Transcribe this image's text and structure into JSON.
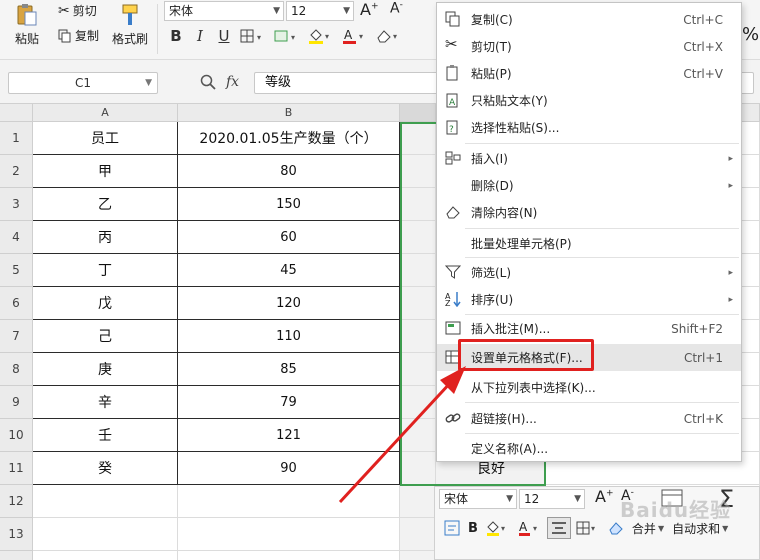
{
  "ribbon": {
    "paste": "粘贴",
    "cut": "剪切",
    "copy": "复制",
    "format_painter": "格式刷",
    "font_name": "宋体",
    "font_size": "12",
    "percent": "%"
  },
  "formula_bar": {
    "cell_ref": "C1",
    "fx": "fx",
    "value": "等级"
  },
  "grid": {
    "columns": [
      "A",
      "B"
    ],
    "rows": [
      {
        "num": "1",
        "a": "员工",
        "b": "2020.01.05生产数量（个）"
      },
      {
        "num": "2",
        "a": "甲",
        "b": "80"
      },
      {
        "num": "3",
        "a": "乙",
        "b": "150"
      },
      {
        "num": "4",
        "a": "丙",
        "b": "60"
      },
      {
        "num": "5",
        "a": "丁",
        "b": "45"
      },
      {
        "num": "6",
        "a": "戊",
        "b": "120"
      },
      {
        "num": "7",
        "a": "己",
        "b": "110"
      },
      {
        "num": "8",
        "a": "庚",
        "b": "85"
      },
      {
        "num": "9",
        "a": "辛",
        "b": "79"
      },
      {
        "num": "10",
        "a": "壬",
        "b": "121"
      },
      {
        "num": "11",
        "a": "癸",
        "b": "90"
      },
      {
        "num": "12",
        "a": "",
        "b": ""
      },
      {
        "num": "13",
        "a": "",
        "b": ""
      },
      {
        "num": "14",
        "a": "",
        "b": ""
      }
    ],
    "c11_value": "良好"
  },
  "context_menu": {
    "items": [
      {
        "label": "复制(C)",
        "shortcut": "Ctrl+C"
      },
      {
        "label": "剪切(T)",
        "shortcut": "Ctrl+X"
      },
      {
        "label": "粘贴(P)",
        "shortcut": "Ctrl+V"
      },
      {
        "label": "只粘贴文本(Y)",
        "shortcut": ""
      },
      {
        "label": "选择性粘贴(S)...",
        "shortcut": ""
      },
      {
        "label": "插入(I)",
        "shortcut": ""
      },
      {
        "label": "删除(D)",
        "shortcut": ""
      },
      {
        "label": "清除内容(N)",
        "shortcut": ""
      },
      {
        "label": "批量处理单元格(P)",
        "shortcut": ""
      },
      {
        "label": "筛选(L)",
        "shortcut": ""
      },
      {
        "label": "排序(U)",
        "shortcut": ""
      },
      {
        "label": "插入批注(M)...",
        "shortcut": "Shift+F2"
      },
      {
        "label": "设置单元格格式(F)...",
        "shortcut": "Ctrl+1"
      },
      {
        "label": "从下拉列表中选择(K)...",
        "shortcut": ""
      },
      {
        "label": "超链接(H)...",
        "shortcut": "Ctrl+K"
      },
      {
        "label": "定义名称(A)...",
        "shortcut": ""
      }
    ]
  },
  "mini_toolbar": {
    "font_name": "宋体",
    "font_size": "12",
    "merge": "合并",
    "autosum": "自动求和"
  },
  "watermark": "Baidu经验",
  "colors": {
    "selection_border": "#3e9e4f",
    "highlight_box": "#e0211f",
    "arrow": "#e0211f"
  }
}
